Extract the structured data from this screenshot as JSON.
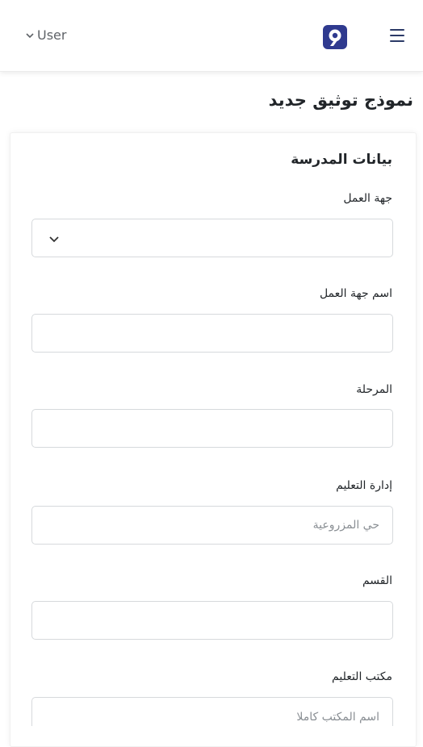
{
  "header": {
    "user_label": "User",
    "logo_icon": "app-logo-icon",
    "menu_icon": "hamburger-menu-icon"
  },
  "page": {
    "title": "نموذج توثيق جديد"
  },
  "section": {
    "title": "بيانات المدرسة"
  },
  "fields": {
    "employer": {
      "label": "جهة العمل",
      "value": ""
    },
    "employer_name": {
      "label": "اسم جهة العمل",
      "value": ""
    },
    "stage": {
      "label": "المرحلة",
      "value": ""
    },
    "education_admin": {
      "label": "إدارة التعليم",
      "placeholder": "حي المزروعية"
    },
    "department": {
      "label": "القسم",
      "value": ""
    },
    "education_office": {
      "label": "مكتب التعليم",
      "placeholder": "اسم المكتب كاملا"
    }
  },
  "colors": {
    "logo_blue": "#2f3a8f",
    "border": "#d6d9dc"
  }
}
